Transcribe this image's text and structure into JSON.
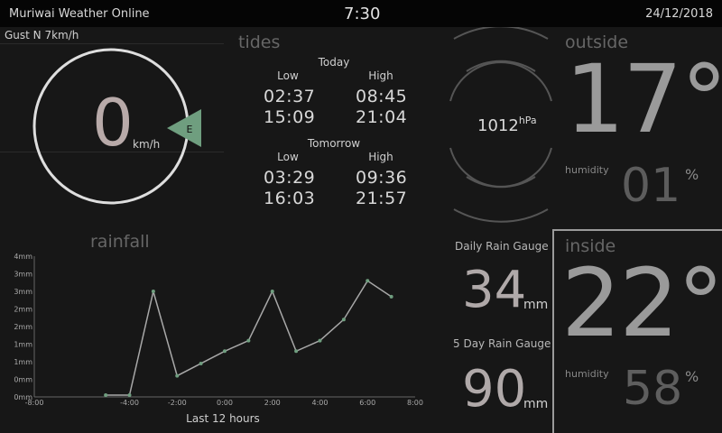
{
  "header": {
    "app_title": "Muriwai Weather Online",
    "time": "7:30",
    "date": "24/12/2018"
  },
  "wind": {
    "gust": "Gust N 7km/h",
    "speed": "0",
    "unit": "km/h",
    "direction": "E",
    "pointer_color": "#6f9e7f"
  },
  "tides": {
    "title": "tides",
    "today": {
      "label": "Today",
      "low_label": "Low",
      "high_label": "High",
      "low": [
        "02:37",
        "15:09"
      ],
      "high": [
        "08:45",
        "21:04"
      ]
    },
    "tomorrow": {
      "label": "Tomorrow",
      "low_label": "Low",
      "high_label": "High",
      "low": [
        "03:29",
        "16:03"
      ],
      "high": [
        "09:36",
        "21:57"
      ]
    }
  },
  "pressure": {
    "value": "1012",
    "unit": "hPa"
  },
  "outside": {
    "title": "outside",
    "temp": "17°",
    "humidity_label": "humidity",
    "humidity": "01",
    "humidity_unit": "%"
  },
  "inside": {
    "title": "inside",
    "temp": "22°",
    "humidity_label": "humidity",
    "humidity": "58",
    "humidity_unit": "%"
  },
  "rain": {
    "title": "rainfall",
    "daily_label": "Daily Rain Gauge",
    "daily_value": "34",
    "daily_unit": "mm",
    "five_day_label": "5 Day Rain Gauge",
    "five_day_value": "90",
    "five_day_unit": "mm"
  },
  "chart_data": {
    "type": "line",
    "title": "rainfall",
    "xlabel": "Last 12 hours",
    "ylabel": "",
    "x_ticks": [
      "-8:00",
      "-4:00",
      "-2:00",
      "0:00",
      "2:00",
      "4:00",
      "6:00",
      "8:00"
    ],
    "y_ticks": [
      "0mm",
      "0mm",
      "1mm",
      "1mm",
      "2mm",
      "2mm",
      "3mm",
      "3mm",
      "4mm"
    ],
    "xlim": [
      -8,
      8
    ],
    "ylim": [
      0,
      4
    ],
    "grid": false,
    "line_color": "#a8a8a8",
    "point_color": "#6f9e7f",
    "series": [
      {
        "x": [
          -5,
          -4,
          -3,
          -2,
          -1,
          0,
          1,
          2,
          3,
          4,
          5,
          6,
          7
        ],
        "values": [
          0.05,
          0.05,
          3.0,
          0.6,
          0.95,
          1.3,
          1.6,
          3.0,
          1.3,
          1.6,
          2.2,
          3.3,
          2.85
        ]
      }
    ]
  }
}
